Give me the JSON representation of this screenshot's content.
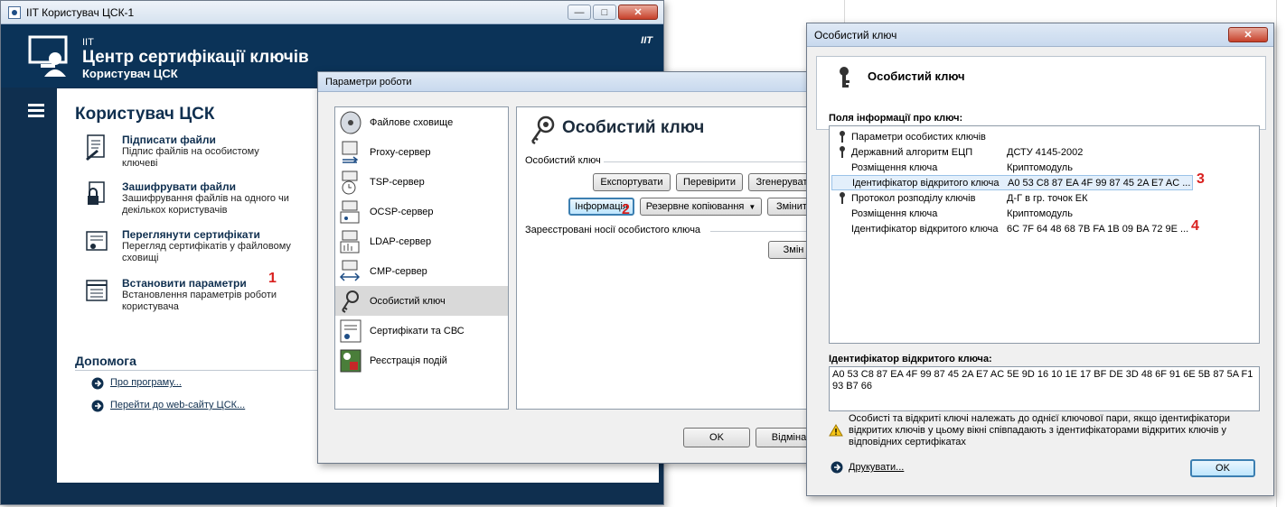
{
  "main_window": {
    "title": "IIT Користувач ЦСК-1",
    "banner_small": "IIT",
    "banner_title": "Центр сертифікації ключів",
    "banner_subtitle": "Користувач ЦСК",
    "banner_brand": "IIT",
    "section_title": "Користувач ЦСК",
    "actions": [
      {
        "title": "Підписати файли",
        "desc": "Підпис файлів на особистому ключеві",
        "icon": "sign-document-icon"
      },
      {
        "title": "Зашифрувати файли",
        "desc": "Зашифрування файлів на одного чи декількох користувачів",
        "icon": "encrypt-file-icon"
      },
      {
        "title": "Переглянути сертифікати",
        "desc": "Перегляд сертифікатів у файловому сховищі",
        "icon": "certificate-icon"
      },
      {
        "title": "Встановити параметри",
        "desc": "Встановлення параметрів роботи користувача",
        "icon": "settings-list-icon"
      }
    ],
    "annotation_1": "1",
    "help_title": "Допомога",
    "help_links": [
      "Про програму...",
      "Перейти до web-сайту ЦСК..."
    ]
  },
  "params_window": {
    "title": "Параметри роботи",
    "nav_items": [
      {
        "label": "Файлове сховище",
        "icon": "file-storage-icon"
      },
      {
        "label": "Proxy-сервер",
        "icon": "proxy-server-icon"
      },
      {
        "label": "TSP-сервер",
        "icon": "tsp-server-icon"
      },
      {
        "label": "OCSP-сервер",
        "icon": "ocsp-server-icon"
      },
      {
        "label": "LDAP-сервер",
        "icon": "ldap-server-icon"
      },
      {
        "label": "CMP-сервер",
        "icon": "cmp-server-icon"
      },
      {
        "label": "Особистий ключ",
        "icon": "private-key-icon",
        "selected": true
      },
      {
        "label": "Сертифікати та СВС",
        "icon": "certificates-crl-icon"
      },
      {
        "label": "Реєстрація подій",
        "icon": "event-log-icon"
      }
    ],
    "panel_title": "Особистий ключ",
    "group_key": "Особистий ключ",
    "buttons_row1": [
      "Експортувати",
      "Перевірити",
      "Згенерувати"
    ],
    "buttons_row2": [
      "Інформація",
      "Резервне копіювання",
      "Змінити"
    ],
    "annotation_2": "2",
    "group_media": "Зареєстровані носії особистого ключа",
    "media_button": "Змін",
    "ok_button": "OK",
    "cancel_button": "Відміна"
  },
  "key_window": {
    "title": "Особистий ключ",
    "header_title": "Особистий ключ",
    "fields_label": "Поля інформації про ключ:",
    "fields": [
      {
        "name": "Параметри особистих ключів",
        "value": "",
        "icon": true,
        "indent": 0
      },
      {
        "name": "Державний алгоритм ЕЦП",
        "value": "ДСТУ 4145-2002",
        "icon": true,
        "indent": 0
      },
      {
        "name": "Розміщення ключа",
        "value": "Криптомодуль",
        "icon": false,
        "indent": 1
      },
      {
        "name": "Ідентифікатор відкритого ключа",
        "value": "A0 53 C8 87 EA 4F 99 87 45 2A E7 AC ...",
        "icon": false,
        "indent": 1,
        "selected": true
      },
      {
        "name": "Протокол розподілу ключів",
        "value": "Д-Г в гр. точок ЕК",
        "icon": true,
        "indent": 0
      },
      {
        "name": "Розміщення ключа",
        "value": "Криптомодуль",
        "icon": false,
        "indent": 1
      },
      {
        "name": "Ідентифікатор відкритого ключа",
        "value": "6C 7F 64 48 68 7B FA 1B 09 BA 72 9E ...",
        "icon": false,
        "indent": 1
      }
    ],
    "annotation_3": "3",
    "annotation_4": "4",
    "pubkey_label": "Ідентифікатор відкритого ключа:",
    "pubkey_value": "A0 53 C8 87 EA 4F 99 87 45 2A E7 AC 5E 9D 16 10 1E 17 BF DE 3D 48 6F 91 6E 5B 87 5A F1 93 B7 66",
    "warning": "Особисті та відкриті ключі належать до однієї ключової пари, якщо ідентифікатори відкритих ключів у цьому вікні співпадають з ідентифікаторами відкритих ключів у відповідних сертифікатах",
    "print_link": "Друкувати...",
    "ok_button": "OK"
  },
  "colors": {
    "brand_navy": "#0b3358",
    "annotation_red": "#d9211f"
  }
}
